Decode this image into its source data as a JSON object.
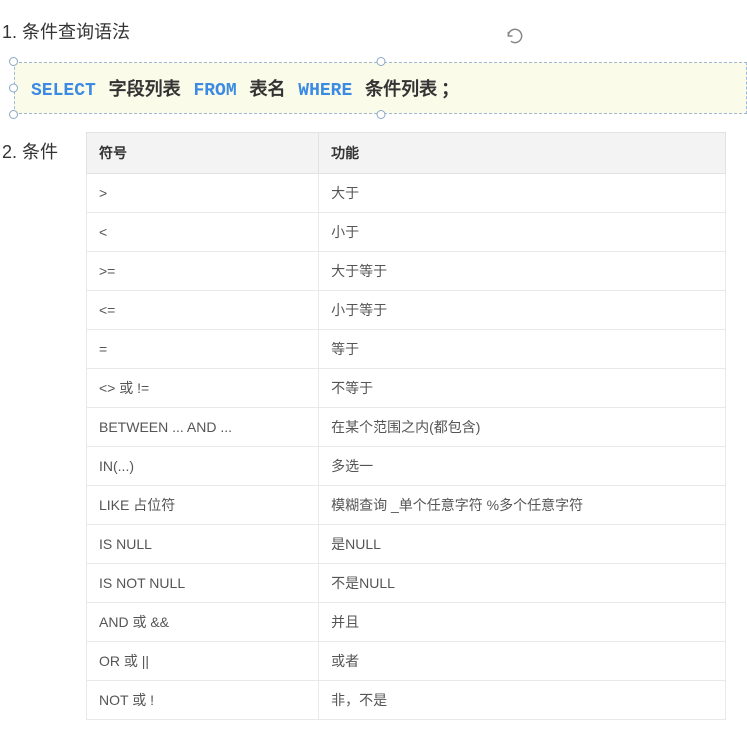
{
  "section1": {
    "title": "1. 条件查询语法"
  },
  "code": {
    "kw_select": "SELECT",
    "tok_fields": "字段列表",
    "kw_from": "FROM",
    "tok_table": "表名",
    "kw_where": "WHERE",
    "tok_cond": "条件列表",
    "tok_semi": "；"
  },
  "section2": {
    "title": "2. 条件"
  },
  "table": {
    "header_symbol": "符号",
    "header_function": "功能",
    "rows": [
      {
        "symbol": ">",
        "func": "大于"
      },
      {
        "symbol": "<",
        "func": "小于"
      },
      {
        "symbol": ">=",
        "func": "大于等于"
      },
      {
        "symbol": "<=",
        "func": "小于等于"
      },
      {
        "symbol": "=",
        "func": "等于"
      },
      {
        "symbol": "<> 或 !=",
        "func": "不等于"
      },
      {
        "symbol": "BETWEEN ... AND ...",
        "func": "在某个范围之内(都包含)"
      },
      {
        "symbol": "IN(...)",
        "func": "多选一"
      },
      {
        "symbol": "LIKE 占位符",
        "func": "模糊查询  _单个任意字符  %多个任意字符"
      },
      {
        "symbol": "IS NULL",
        "func": "是NULL"
      },
      {
        "symbol": "IS NOT NULL",
        "func": "不是NULL"
      },
      {
        "symbol": "AND 或 &&",
        "func": "并且"
      },
      {
        "symbol": "OR 或 ||",
        "func": "或者"
      },
      {
        "symbol": "NOT 或 !",
        "func": "非，不是"
      }
    ]
  }
}
